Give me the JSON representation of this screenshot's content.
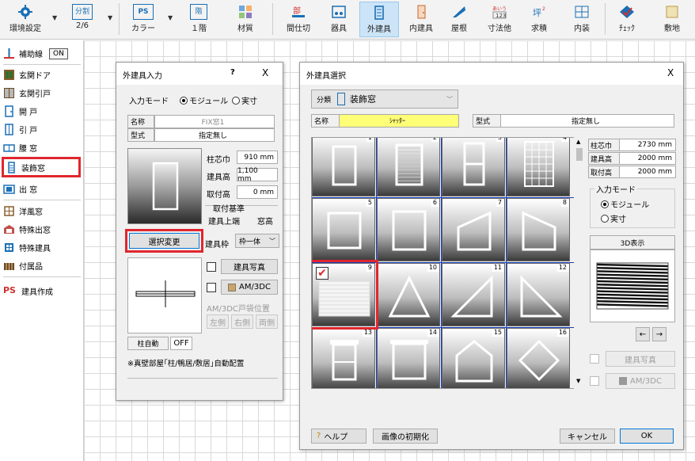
{
  "toolbar": {
    "items": [
      {
        "label": "環境設定"
      },
      {
        "label": "2/6",
        "top": "分割"
      },
      {
        "label": "カラー",
        "top": "PS"
      },
      {
        "label": "１階",
        "top": "階"
      },
      {
        "label": "材質"
      },
      {
        "label": "間仕切"
      },
      {
        "label": "器具"
      },
      {
        "label": "外建具"
      },
      {
        "label": "内建具"
      },
      {
        "label": "屋根"
      },
      {
        "label": "寸法他"
      },
      {
        "label": "求積"
      },
      {
        "label": "内装"
      },
      {
        "label": "ﾁｪｯｸ"
      },
      {
        "label": "敷地"
      }
    ],
    "active": "外建具",
    "colors": {
      "blue": "#1a6fb5",
      "red": "#d03030"
    }
  },
  "left_menu": {
    "items": [
      {
        "label": "補助線",
        "badge": "ON"
      },
      {
        "label": "玄関ドア"
      },
      {
        "label": "玄関引戸"
      },
      {
        "label": "開 戸"
      },
      {
        "label": "引 戸"
      },
      {
        "label": "腰 窓"
      },
      {
        "label": "装飾窓"
      },
      {
        "label": "出 窓"
      },
      {
        "label": "洋風窓"
      },
      {
        "label": "特殊出窓"
      },
      {
        "label": "特殊建具"
      },
      {
        "label": "付属品"
      },
      {
        "label": "建具作成",
        "prefix": "PS"
      }
    ],
    "selected": "装飾窓",
    "highlight_color": "#e0262e"
  },
  "input_dialog": {
    "title": "外建具入力",
    "help": "?",
    "close": "X",
    "mode_label": "入力モード",
    "mode_options": [
      "モジュール",
      "実寸"
    ],
    "mode_selected": "モジュール",
    "name_label": "名称",
    "name_value": "FIX窓1",
    "type_label": "型式",
    "type_value": "指定無し",
    "pillar_width_label": "柱芯巾",
    "pillar_width_value": "910 mm",
    "fitting_height_label": "建具高",
    "fitting_height_value": "1,100 mm",
    "mount_height_label": "取付高",
    "mount_height_value": "0 mm",
    "mount_basis_label": "取付基準",
    "mount_basis_value": "建具上端",
    "mount_basis_type": "窓高",
    "change_button": "選択変更",
    "frame_label": "建具枠",
    "frame_value": "枠一体",
    "photo_button": "建具写真",
    "am3dc_button": "AM/3DC",
    "am3dc_pos_label": "AM/3DC戸袋位置",
    "pos_buttons": [
      "左側",
      "右側",
      "両側"
    ],
    "pillar_auto_label": "柱自動",
    "pillar_auto_value": "OFF",
    "note": "※真壁部屋｢柱/鴨居/敷居｣自動配置"
  },
  "select_dialog": {
    "title": "外建具選択",
    "close": "X",
    "category_label": "分類",
    "category_value": "装飾窓",
    "name_label": "名称",
    "name_value": "ｼｬｯﾀｰ",
    "type_label": "型式",
    "type_value": "指定無し",
    "grid_numbers": [
      "1",
      "2",
      "3",
      "4",
      "5",
      "6",
      "7",
      "8",
      "9",
      "10",
      "11",
      "12",
      "13",
      "14",
      "15",
      "16"
    ],
    "selected_cell": "9",
    "props": [
      {
        "label": "柱芯巾",
        "value": "2730 mm"
      },
      {
        "label": "建具高",
        "value": "2000 mm"
      },
      {
        "label": "取付高",
        "value": "2000 mm"
      }
    ],
    "mode_label": "入力モード",
    "mode_options": [
      "モジュール",
      "実寸"
    ],
    "mode_selected": "モジュール",
    "view3d_label": "3D表示",
    "arrows": [
      "←",
      "→"
    ],
    "photo_button": "建具写真",
    "am3dc_button": "AM/3DC",
    "help_button": "ヘルプ",
    "reset_button": "画像の初期化",
    "cancel_button": "キャンセル",
    "ok_button": "OK",
    "name_highlight": "#fefe77"
  }
}
